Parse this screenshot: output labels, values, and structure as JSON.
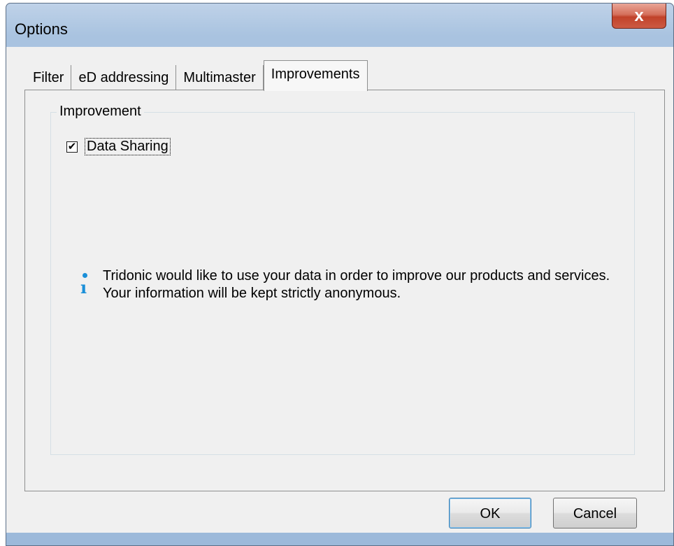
{
  "window": {
    "title": "Options",
    "close_glyph": "x"
  },
  "tabs": [
    {
      "label": "Filter",
      "active": false
    },
    {
      "label": "eD addressing",
      "active": false
    },
    {
      "label": "Multimaster",
      "active": false
    },
    {
      "label": "Improvements",
      "active": true
    }
  ],
  "improvement_group": {
    "label": "Improvement",
    "data_sharing": {
      "label": "Data Sharing",
      "checked": true,
      "check_glyph": "✔"
    },
    "info": {
      "icon": "info-icon",
      "text": "Tridonic would like to use your data in order to improve our products and services. Your information will be kept strictly anonymous."
    }
  },
  "buttons": {
    "ok_label": "OK",
    "cancel_label": "Cancel"
  },
  "colors": {
    "info_blue": "#1a8fd8",
    "close_red": "#c1422a"
  }
}
